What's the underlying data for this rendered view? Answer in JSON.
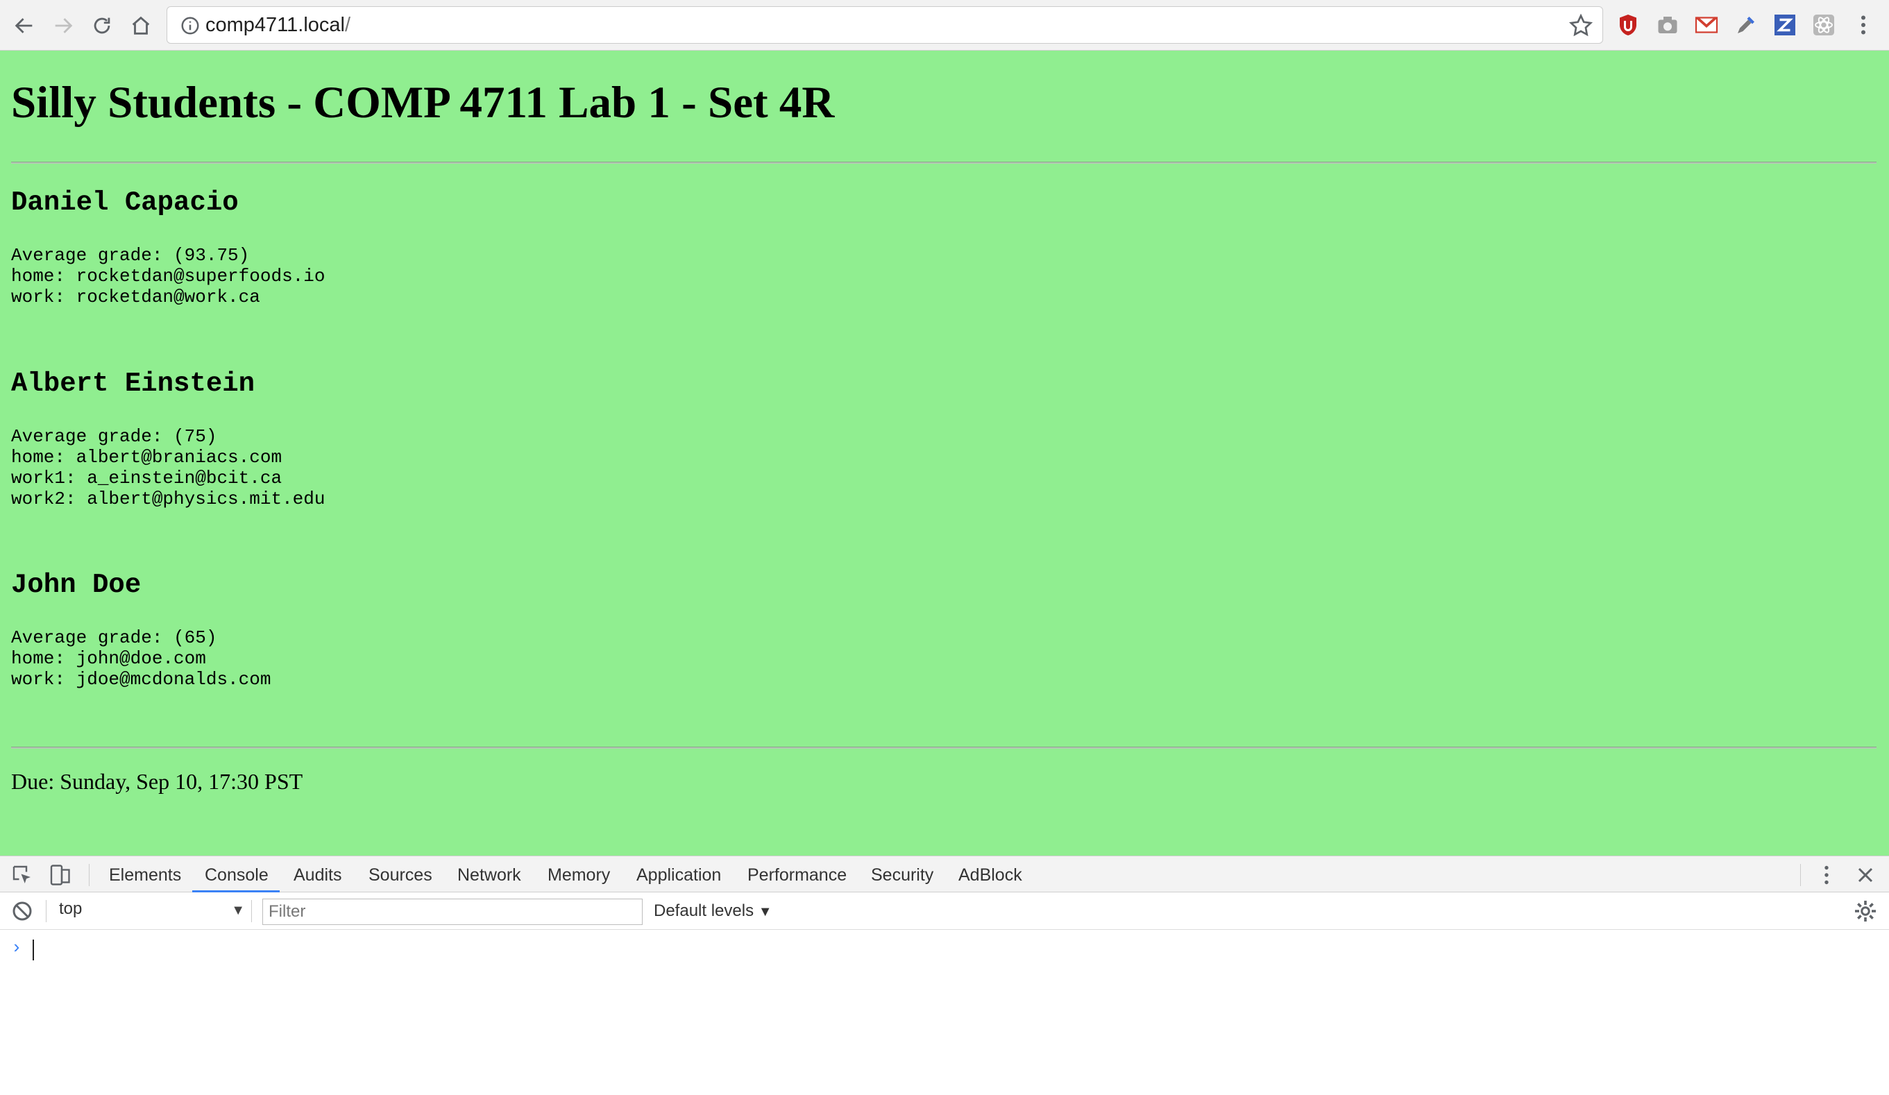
{
  "browser": {
    "url_host": "comp4711.local",
    "url_path": "/"
  },
  "page": {
    "title": "Silly Students - COMP 4711 Lab 1 - Set 4R",
    "students": [
      {
        "name": "Daniel Capacio",
        "lines": [
          "Average grade: (93.75)",
          "home: rocketdan@superfoods.io",
          "work: rocketdan@work.ca"
        ]
      },
      {
        "name": "Albert Einstein",
        "lines": [
          "Average grade: (75)",
          "home: albert@braniacs.com",
          "work1: a_einstein@bcit.ca",
          "work2: albert@physics.mit.edu"
        ]
      },
      {
        "name": "John Doe",
        "lines": [
          "Average grade: (65)",
          "home: john@doe.com",
          "work: jdoe@mcdonalds.com"
        ]
      }
    ],
    "due": "Due: Sunday, Sep 10, 17:30 PST",
    "background_color": "#90ee90"
  },
  "devtools": {
    "tabs": [
      "Elements",
      "Console",
      "Audits",
      "Sources",
      "Network",
      "Memory",
      "Application",
      "Performance",
      "Security",
      "AdBlock"
    ],
    "active_tab": "Console",
    "context": "top",
    "filter_placeholder": "Filter",
    "levels": "Default levels",
    "prompt": "›"
  }
}
